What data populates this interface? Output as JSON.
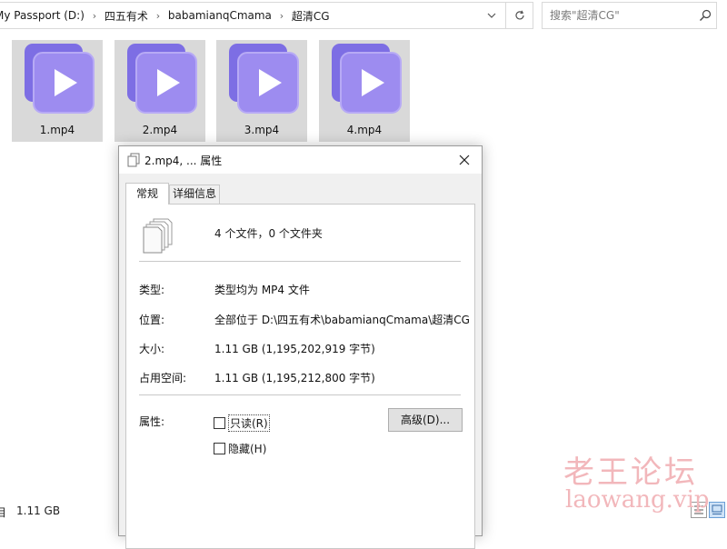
{
  "explorer": {
    "breadcrumbs": [
      "My Passport (D:)",
      "四五有术",
      "babamianqCmama",
      "超清CG"
    ],
    "search": {
      "placeholder": "搜索\"超清CG\""
    },
    "files": [
      {
        "name": "1.mp4"
      },
      {
        "name": "2.mp4"
      },
      {
        "name": "3.mp4"
      },
      {
        "name": "4.mp4"
      }
    ],
    "status": {
      "items_label": "目",
      "size": "1.11 GB"
    }
  },
  "dialog": {
    "title": "2.mp4, ... 属性",
    "tabs": [
      "常规",
      "详细信息"
    ],
    "summary": "4 个文件，0 个文件夹",
    "rows": [
      {
        "label": "类型:",
        "value": "类型均为 MP4 文件"
      },
      {
        "label": "位置:",
        "value": "全部位于 D:\\四五有术\\babamianqCmama\\超清CG"
      },
      {
        "label": "大小:",
        "value": "1.11 GB (1,195,202,919 字节)"
      },
      {
        "label": "占用空间:",
        "value": "1.11 GB (1,195,212,800 字节)"
      }
    ],
    "attributes_label": "属性:",
    "readonly": {
      "label": "只读(R)",
      "checked": false
    },
    "hidden": {
      "label": "隐藏(H)",
      "checked": false
    },
    "advanced_button": "高级(D)..."
  },
  "watermark": {
    "line1": "老王论坛",
    "line2": "laowang.vip"
  },
  "colors": {
    "video_icon": "#9d8cf0",
    "video_icon_dark": "#7d6ee4",
    "tile_bg": "#d9d9d9",
    "dialog_bg": "#f0f0f0",
    "watermark": "#f2b7bb"
  }
}
